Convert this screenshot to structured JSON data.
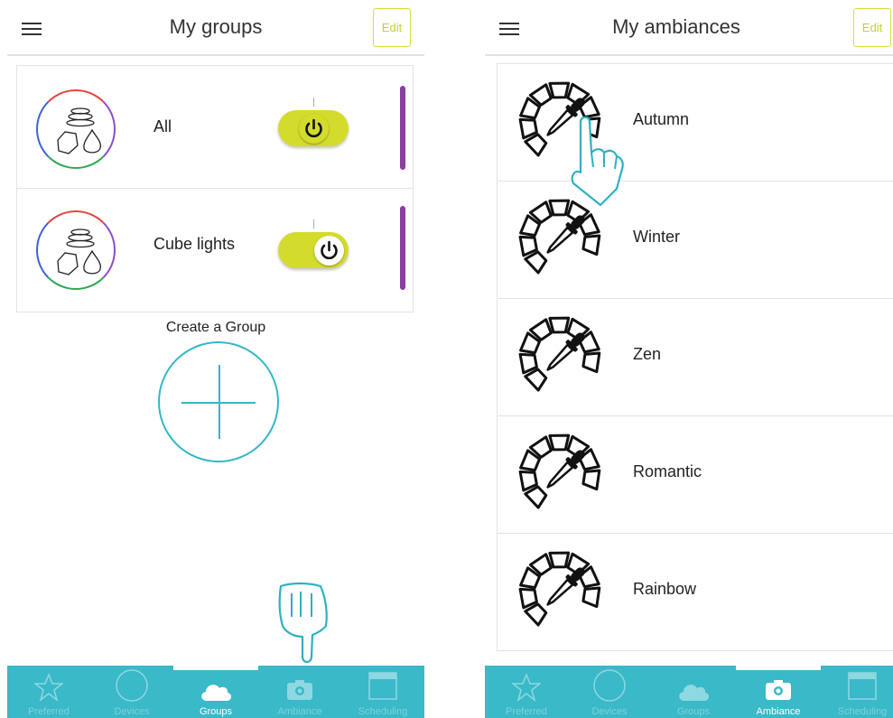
{
  "left_screen": {
    "header": {
      "title": "My groups",
      "edit_label": "Edit"
    },
    "groups": [
      {
        "name": "All",
        "on": true
      },
      {
        "name": "Cube lights",
        "on": true
      }
    ],
    "create_group_label": "Create a Group",
    "tabs": [
      {
        "label": "Preferred",
        "icon": "star-icon",
        "active": false
      },
      {
        "label": "Devices",
        "icon": "circle-icon",
        "active": false
      },
      {
        "label": "Groups",
        "icon": "cloud-icon",
        "active": true
      },
      {
        "label": "Ambiance",
        "icon": "camera-icon",
        "active": false
      },
      {
        "label": "Scheduling",
        "icon": "calendar-icon",
        "active": false
      }
    ]
  },
  "right_screen": {
    "header": {
      "title": "My ambiances",
      "edit_label": "Edit"
    },
    "ambiances": [
      {
        "name": "Autumn"
      },
      {
        "name": "Winter"
      },
      {
        "name": "Zen"
      },
      {
        "name": "Romantic"
      },
      {
        "name": "Rainbow"
      }
    ],
    "tabs": [
      {
        "label": "Preferred",
        "icon": "star-icon",
        "active": false
      },
      {
        "label": "Devices",
        "icon": "circle-icon",
        "active": false
      },
      {
        "label": "Groups",
        "icon": "cloud-icon",
        "active": false
      },
      {
        "label": "Ambiance",
        "icon": "camera-icon",
        "active": true
      },
      {
        "label": "Scheduling",
        "icon": "calendar-icon",
        "active": false
      }
    ]
  },
  "colors": {
    "accent": "#3ab9c8",
    "toggle": "#d3dc2c",
    "edit": "#c8cf2a",
    "group_bar": "#8b3fa0",
    "create_circle": "#33b7c9"
  }
}
